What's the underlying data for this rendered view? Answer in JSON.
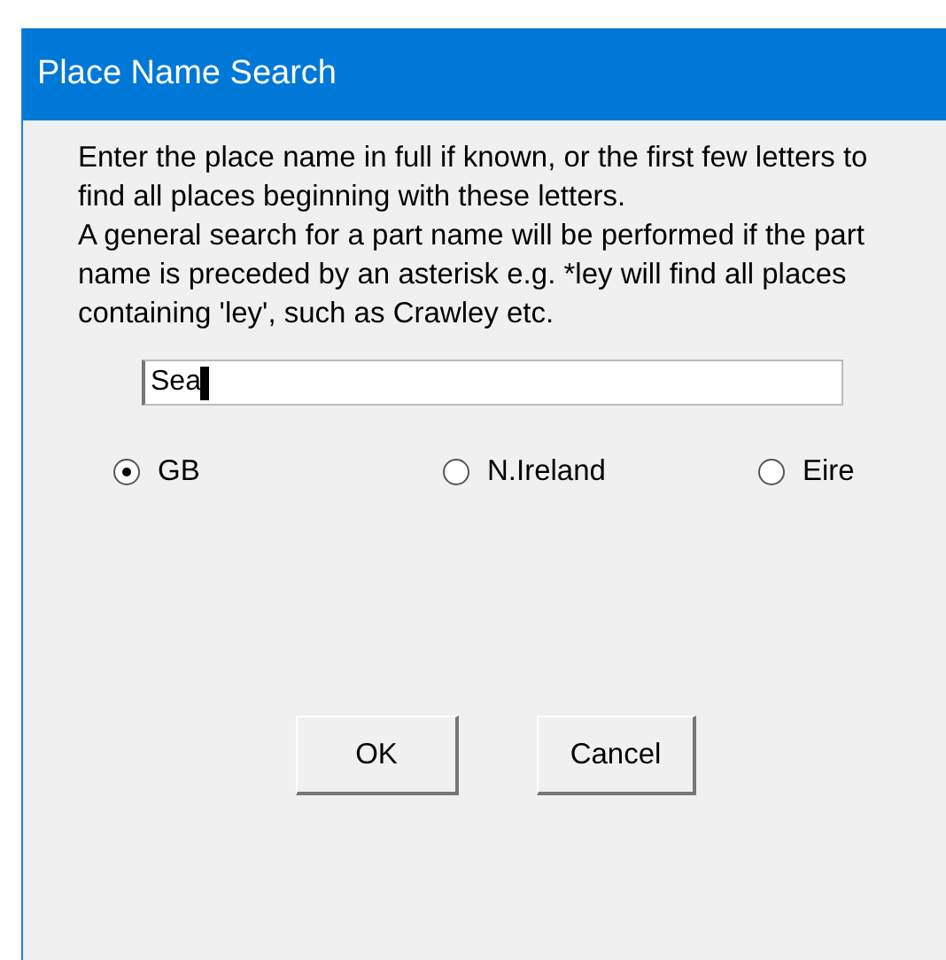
{
  "window": {
    "title": "Place Name Search"
  },
  "instructions": [
    "Enter the place name in full if known, or the first few letters to find all places beginning with these letters.",
    "A general search for a part name will be performed if the part name is preceded by an asterisk e.g. *ley will find all places containing 'ley', such as Crawley etc."
  ],
  "search": {
    "value": "Sea"
  },
  "regions": [
    {
      "label": "GB",
      "selected": true
    },
    {
      "label": "N.Ireland",
      "selected": false
    },
    {
      "label": "Eire",
      "selected": false
    }
  ],
  "buttons": [
    "OK",
    "Cancel"
  ]
}
